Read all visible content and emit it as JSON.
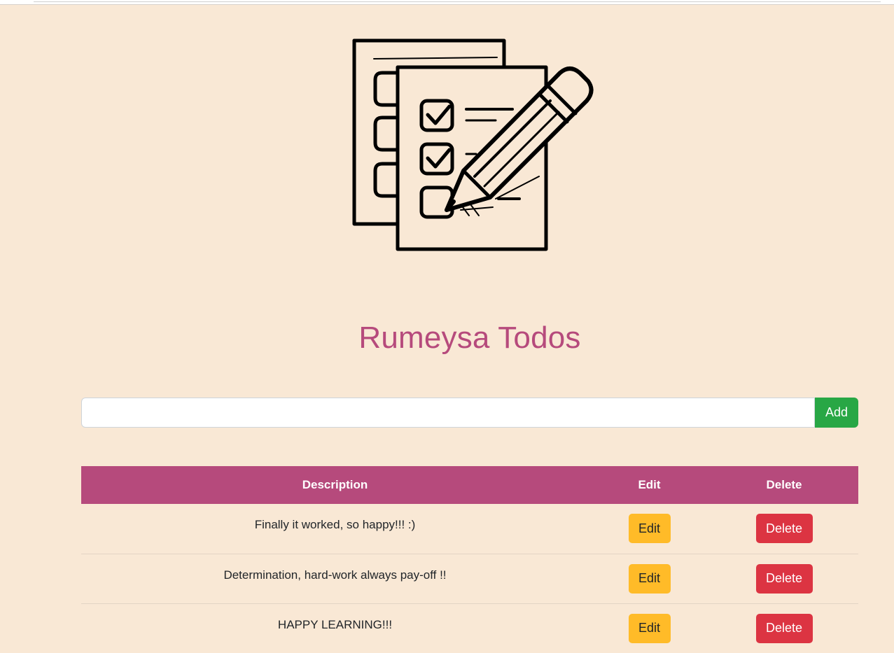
{
  "app": {
    "title": "Rumeysa Todos",
    "logo_icon": "checklist-with-pencil-icon"
  },
  "add_form": {
    "input_value": "",
    "input_placeholder": "",
    "add_label": "Add"
  },
  "table": {
    "headers": {
      "description": "Description",
      "edit": "Edit",
      "delete": "Delete"
    },
    "rows": [
      {
        "description": "Finally it worked, so happy!!! :)",
        "edit_label": "Edit",
        "delete_label": "Delete"
      },
      {
        "description": "Determination, hard-work always pay-off !!",
        "edit_label": "Edit",
        "delete_label": "Delete"
      },
      {
        "description": "HAPPY LEARNING!!!",
        "edit_label": "Edit",
        "delete_label": "Delete"
      }
    ]
  },
  "colors": {
    "background": "#f9e8d5",
    "accent": "#b64a7c",
    "add_button": "#28a745",
    "edit_button": "#ffbb28",
    "delete_button": "#dc3442"
  }
}
